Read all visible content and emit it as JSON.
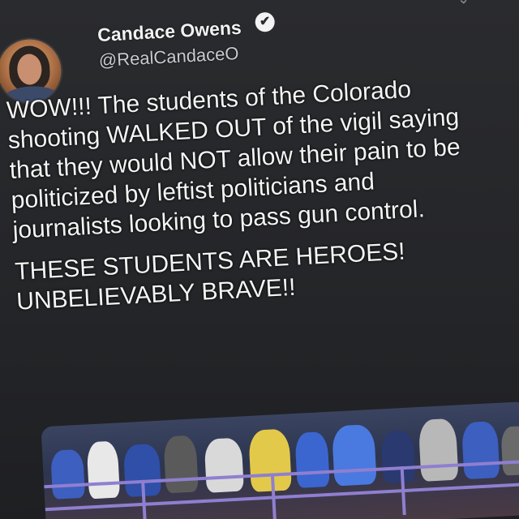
{
  "tweet": {
    "author_name": "Candace Owens",
    "author_handle": "@RealCandaceO",
    "verified_glyph": "✔",
    "menu_glyph": "⌄",
    "paragraphs": [
      "WOW!!! The students of the Colorado shooting WALKED OUT of the vigil saying that they would NOT allow their pain to be politicized by leftist politicians and journalists looking to pass gun control.",
      "THESE STUDENTS ARE HEROES! UNBELIEVABLY BRAVE!!"
    ]
  },
  "icons": {
    "verified": "verified-badge-icon",
    "menu": "chevron-down-icon",
    "avatar": "profile-avatar"
  },
  "colors": {
    "background": "#2a2b2e",
    "text": "#f4f4f4",
    "handle": "#c9cbd1",
    "railing": "#8f7fd0"
  }
}
